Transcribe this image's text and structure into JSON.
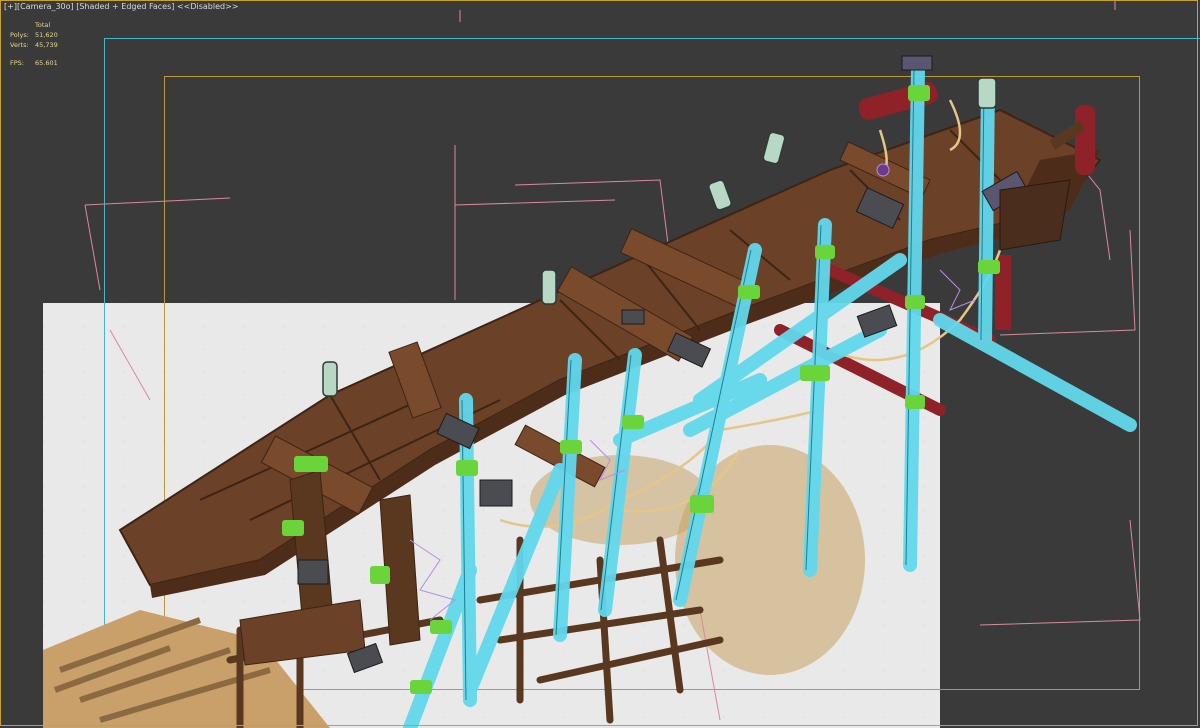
{
  "viewport": {
    "label_plus": "[+]",
    "label_camera": "[Camera_30o]",
    "label_shading": "[Shaded + Edged Faces]",
    "label_disabled": "<<Disabled>>"
  },
  "stats": {
    "header": "Total",
    "polys_label": "Polys:",
    "polys_value": "51,620",
    "verts_label": "Verts:",
    "verts_value": "45,739",
    "fps_label": "FPS:",
    "fps_value": "65.601"
  },
  "colors": {
    "background": "#3a3a3a",
    "wood": "#6b4128",
    "selected_wireframe": "#62d8ec",
    "rope_wrap": "#6ad43b",
    "safe_frame": "#49b6c6",
    "render_frame": "#b89a3a"
  }
}
